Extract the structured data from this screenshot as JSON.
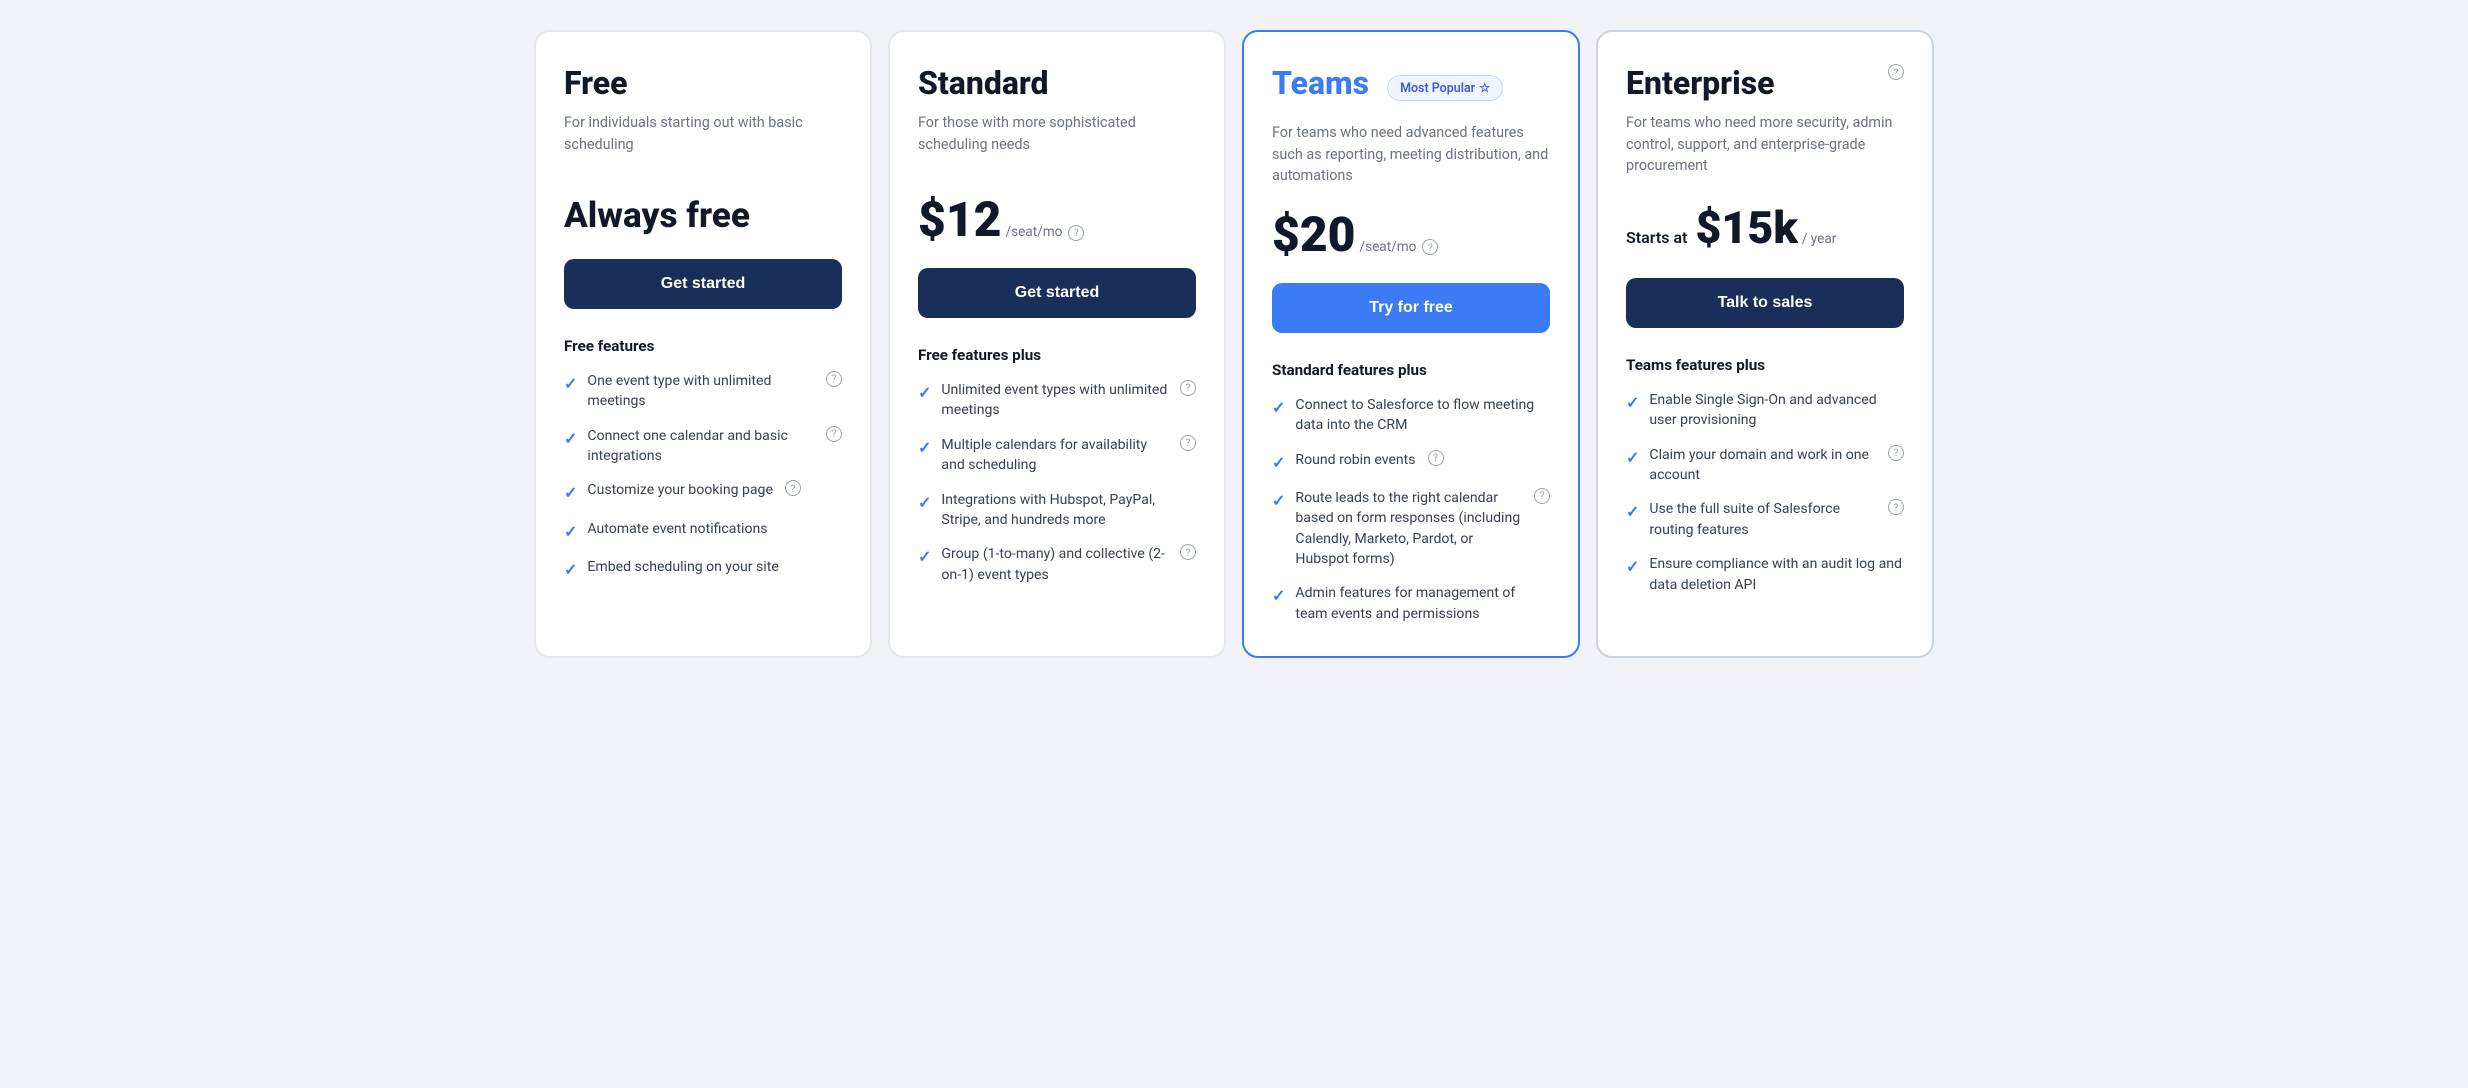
{
  "plans": [
    {
      "id": "free",
      "name": "Free",
      "badge": null,
      "description": "For individuals starting out with basic scheduling",
      "price_display": "always_free",
      "price_label": "Always free",
      "cta_label": "Get started",
      "cta_style": "dark",
      "features_label": "Free features",
      "features": [
        {
          "text": "One event type with unlimited meetings",
          "has_help": true
        },
        {
          "text": "Connect one calendar and basic integrations",
          "has_help": true
        },
        {
          "text": "Customize your booking page",
          "has_help": true
        },
        {
          "text": "Automate event notifications",
          "has_help": false
        },
        {
          "text": "Embed scheduling on your site",
          "has_help": false
        }
      ]
    },
    {
      "id": "standard",
      "name": "Standard",
      "badge": null,
      "description": "For those with more sophisticated scheduling needs",
      "price_display": "per_seat",
      "price_amount": "$12",
      "price_suffix": "/seat/mo",
      "cta_label": "Get started",
      "cta_style": "dark",
      "features_label": "Free features plus",
      "features": [
        {
          "text": "Unlimited event types with unlimited meetings",
          "has_help": true
        },
        {
          "text": "Multiple calendars for availability and scheduling",
          "has_help": true
        },
        {
          "text": "Integrations with Hubspot, PayPal, Stripe, and hundreds more",
          "has_help": false
        },
        {
          "text": "Group (1-to-many) and collective (2-on-1) event types",
          "has_help": true
        }
      ]
    },
    {
      "id": "teams",
      "name": "Teams",
      "badge": "Most Popular",
      "description": "For teams who need advanced features such as reporting, meeting distribution, and automations",
      "price_display": "per_seat",
      "price_amount": "$20",
      "price_suffix": "/seat/mo",
      "cta_label": "Try for free",
      "cta_style": "blue",
      "features_label": "Standard features plus",
      "features": [
        {
          "text": "Connect to Salesforce to flow meeting data into the CRM",
          "has_help": false
        },
        {
          "text": "Round robin events",
          "has_help": true
        },
        {
          "text": "Route leads to the right calendar based on form responses (including Calendly, Marketo, Pardot, or Hubspot forms)",
          "has_help": true
        },
        {
          "text": "Admin features for management of team events and permissions",
          "has_help": false
        }
      ]
    },
    {
      "id": "enterprise",
      "name": "Enterprise",
      "badge": null,
      "description": "For teams who need more security, admin control, support, and enterprise-grade procurement",
      "price_display": "starts_at",
      "price_starts_at": "Starts at",
      "price_amount": "$15k",
      "price_suffix": "/ year",
      "cta_label": "Talk to sales",
      "cta_style": "dark",
      "features_label": "Teams features plus",
      "features": [
        {
          "text": "Enable Single Sign-On and advanced user provisioning",
          "has_help": false
        },
        {
          "text": "Claim your domain and work in one account",
          "has_help": true
        },
        {
          "text": "Use the full suite of Salesforce routing features",
          "has_help": true
        },
        {
          "text": "Ensure compliance with an audit log and data deletion API",
          "has_help": false
        }
      ]
    }
  ]
}
